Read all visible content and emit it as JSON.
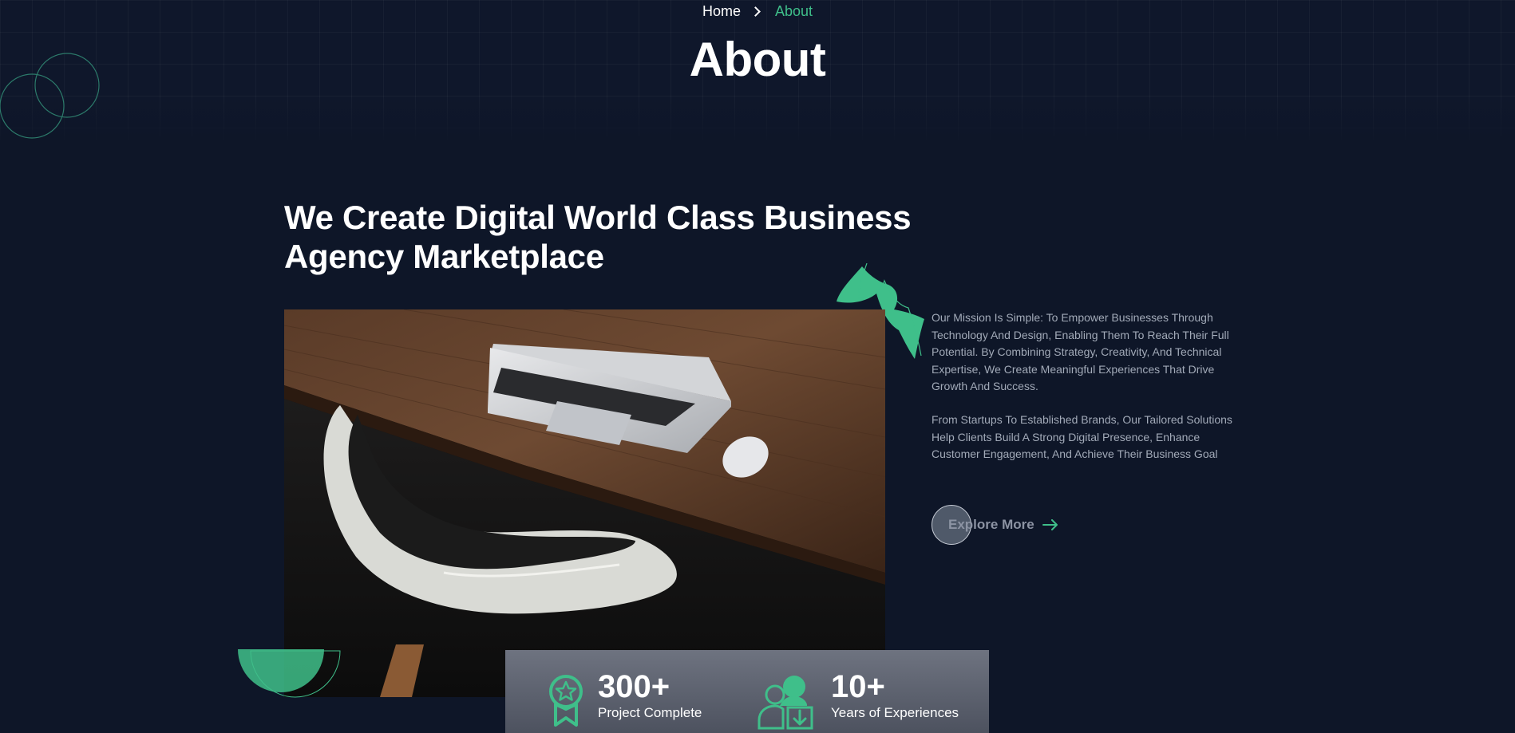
{
  "breadcrumb": {
    "home": "Home",
    "current": "About"
  },
  "page_title": "About",
  "headline": "We Create Digital World Class Business Agency Marketplace",
  "description": [
    "Our Mission Is Simple: To Empower Businesses Through Technology And Design, Enabling Them To Reach Their Full Potential. By Combining Strategy, Creativity, And Technical Expertise, We Create Meaningful Experiences That Drive Growth And Success.",
    "From Startups To Established Brands, Our Tailored Solutions Help Clients Build A Strong Digital Presence, Enhance Customer Engagement, And Achieve Their Business Goal"
  ],
  "explore_button": {
    "label": "Explore More",
    "icon": "arrow-right-icon"
  },
  "stats": [
    {
      "value": "300+",
      "label": "Project Complete",
      "icon": "award-ribbon-icon"
    },
    {
      "value": "10+",
      "label": "Years of Experiences",
      "icon": "people-download-icon"
    }
  ],
  "colors": {
    "background": "#0e1628",
    "accent": "#3fbf8a",
    "muted_text": "#a2aab8"
  }
}
